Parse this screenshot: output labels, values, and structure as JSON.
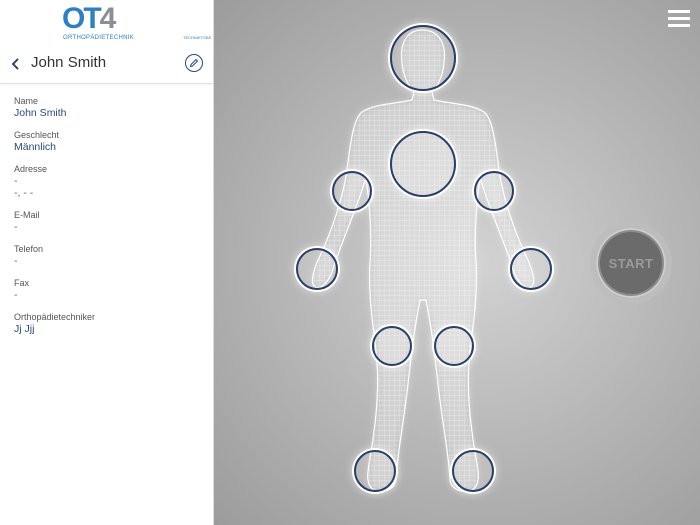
{
  "logo": {
    "brand_a": "OT",
    "brand_b": "4",
    "subtitle": "ORTHOPÄDIETECHNIK",
    "badge": "TECHNIKTOBE"
  },
  "header": {
    "title": "John Smith"
  },
  "fields": [
    {
      "label": "Name",
      "values": [
        "John Smith"
      ],
      "muted": false
    },
    {
      "label": "Geschlecht",
      "values": [
        "Männlich"
      ],
      "muted": false
    },
    {
      "label": "Adresse",
      "values": [
        "-",
        "-, - -"
      ],
      "muted": true
    },
    {
      "label": "E-Mail",
      "values": [
        "-"
      ],
      "muted": true
    },
    {
      "label": "Telefon",
      "values": [
        "-"
      ],
      "muted": true
    },
    {
      "label": "Fax",
      "values": [
        "-"
      ],
      "muted": true
    },
    {
      "label": "Orthopädietechniker",
      "values": [
        "Jj Jjj"
      ],
      "muted": false
    }
  ],
  "main": {
    "start_label": "START"
  },
  "colors": {
    "accent": "#2b4a78",
    "brand": "#2f7fc1",
    "zone_border": "#2b3f6b"
  }
}
